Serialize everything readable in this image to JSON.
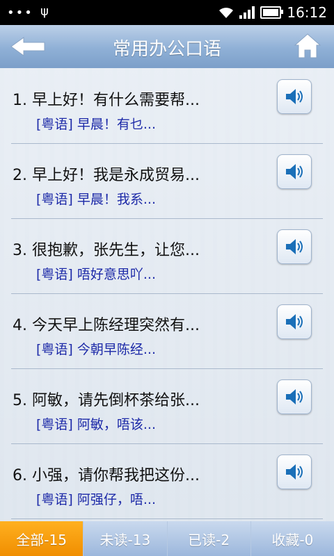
{
  "status_bar": {
    "dots": "•••",
    "time": "16:12",
    "usb_icon": "usb-icon",
    "battery_level": 0.85,
    "signal_bars": 4
  },
  "header": {
    "title": "常用办公口语",
    "back_icon": "back-arrow-icon",
    "home_icon": "home-icon"
  },
  "items": [
    {
      "number": "1.",
      "title": "早上好！有什么需要帮...",
      "subtitle": "[粤语] 早晨！有乜..."
    },
    {
      "number": "2.",
      "title": "早上好！我是永成贸易...",
      "subtitle": "[粤语] 早晨！我系..."
    },
    {
      "number": "3.",
      "title": "很抱歉，张先生，让您...",
      "subtitle": "[粤语] 唔好意思吖..."
    },
    {
      "number": "4.",
      "title": "今天早上陈经理突然有...",
      "subtitle": "[粤语] 今朝早陈经..."
    },
    {
      "number": "5.",
      "title": "阿敏，请先倒杯茶给张...",
      "subtitle": "[粤语] 阿敏，唔该..."
    },
    {
      "number": "6.",
      "title": "小强，请你帮我把这份...",
      "subtitle": "[粤语] 阿强仔，唔..."
    }
  ],
  "tabs": [
    {
      "label": "全部-15",
      "active": true
    },
    {
      "label": "未读-13",
      "active": false
    },
    {
      "label": "已读-2",
      "active": false
    },
    {
      "label": "收藏-0",
      "active": false
    }
  ],
  "colors": {
    "header": "#8fb0d6",
    "subtitle": "#1d2aa8",
    "active_tab": "#f59a0c"
  }
}
